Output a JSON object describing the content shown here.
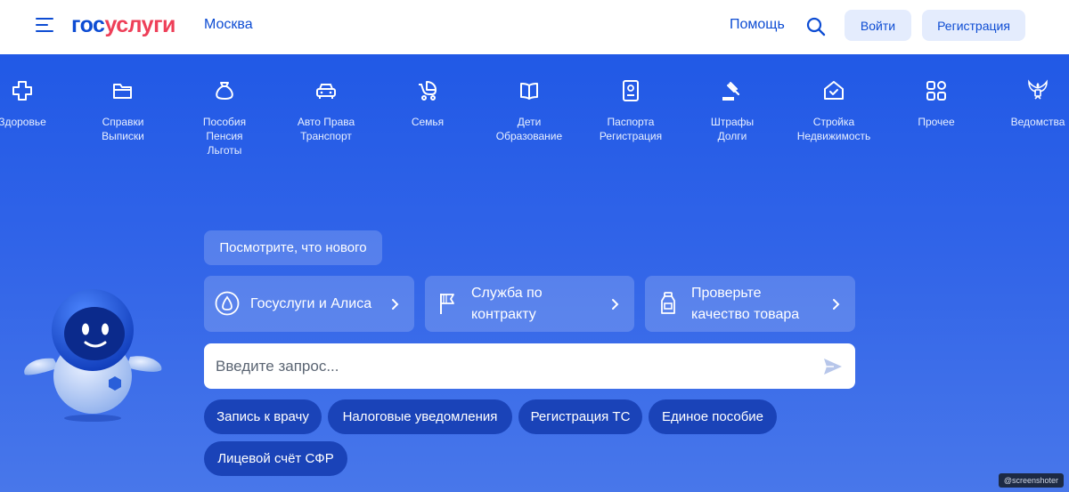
{
  "header": {
    "logo_part1": "гос",
    "logo_part2": "услуги",
    "city": "Москва",
    "help": "Помощь",
    "login": "Войти",
    "register": "Регистрация"
  },
  "categories": [
    {
      "label": "Здоровье",
      "icon": "plus-cross-icon"
    },
    {
      "label": "Справки\nВыписки",
      "icon": "folder-icon"
    },
    {
      "label": "Пособия\nПенсия\nЛьготы",
      "icon": "money-bag-icon"
    },
    {
      "label": "Авто Права\nТранспорт",
      "icon": "car-icon"
    },
    {
      "label": "Семья",
      "icon": "stroller-icon"
    },
    {
      "label": "Дети\nОбразование",
      "icon": "book-icon"
    },
    {
      "label": "Паспорта\nРегистрация",
      "icon": "passport-icon"
    },
    {
      "label": "Штрафы\nДолги",
      "icon": "gavel-icon"
    },
    {
      "label": "Стройка\nНедвижимость",
      "icon": "house-icon"
    },
    {
      "label": "Прочее",
      "icon": "grid-icon"
    },
    {
      "label": "Ведомства",
      "icon": "emblem-icon"
    }
  ],
  "whats_new": "Посмотрите, что нового",
  "cards": [
    {
      "label": "Госуслуги и Алиса",
      "icon": "alice-icon"
    },
    {
      "label": "Служба по\nконтракту",
      "icon": "flag-icon"
    },
    {
      "label": "Проверьте\nкачество товара",
      "icon": "bottle-icon"
    }
  ],
  "search": {
    "placeholder": "Введите запрос..."
  },
  "chips": [
    "Запись к врачу",
    "Налоговые уведомления",
    "Регистрация ТС",
    "Единое пособие",
    "Лицевой счёт СФР"
  ],
  "watermark": "@screenshoter",
  "colors": {
    "brand_blue": "#0d4cd3",
    "brand_red": "#ee3f58",
    "hero_blue": "#2159e6",
    "chip_blue": "#1a43b8"
  }
}
